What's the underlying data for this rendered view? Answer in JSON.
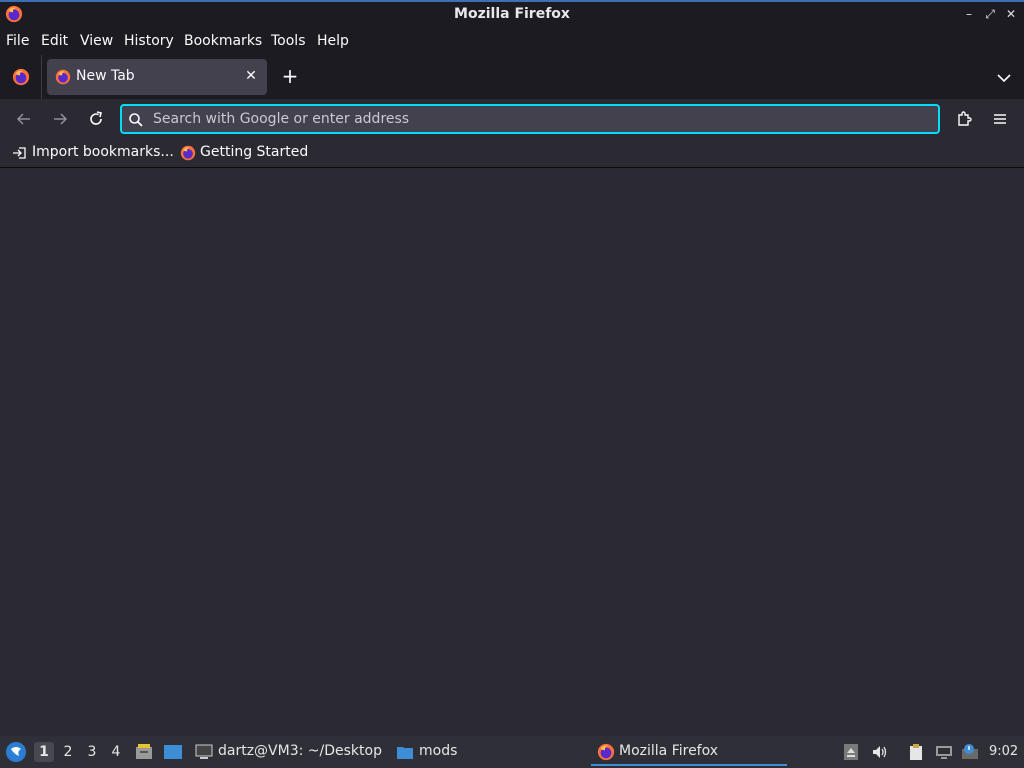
{
  "window": {
    "title": "Mozilla Firefox"
  },
  "menubar": {
    "items": [
      {
        "label": "File"
      },
      {
        "label": "Edit"
      },
      {
        "label": "View"
      },
      {
        "label": "History"
      },
      {
        "label": "Bookmarks"
      },
      {
        "label": "Tools"
      },
      {
        "label": "Help"
      }
    ]
  },
  "tabs": [
    {
      "title": "New Tab"
    }
  ],
  "urlbar": {
    "placeholder": "Search with Google or enter address",
    "value": ""
  },
  "bookmarks": [
    {
      "label": "Import bookmarks..."
    },
    {
      "label": "Getting Started"
    }
  ],
  "taskbar": {
    "workspaces": [
      "1",
      "2",
      "3",
      "4"
    ],
    "active_workspace": "1",
    "tasks": [
      {
        "label": "dartz@VM3: ~/Desktop"
      },
      {
        "label": "mods"
      },
      {
        "label": "Mozilla Firefox"
      }
    ],
    "clock": "9:02"
  },
  "colors": {
    "accent": "#00ddff",
    "toolbar": "#2b2a33",
    "chrome": "#1c1b22",
    "tab_active": "#42414d"
  }
}
